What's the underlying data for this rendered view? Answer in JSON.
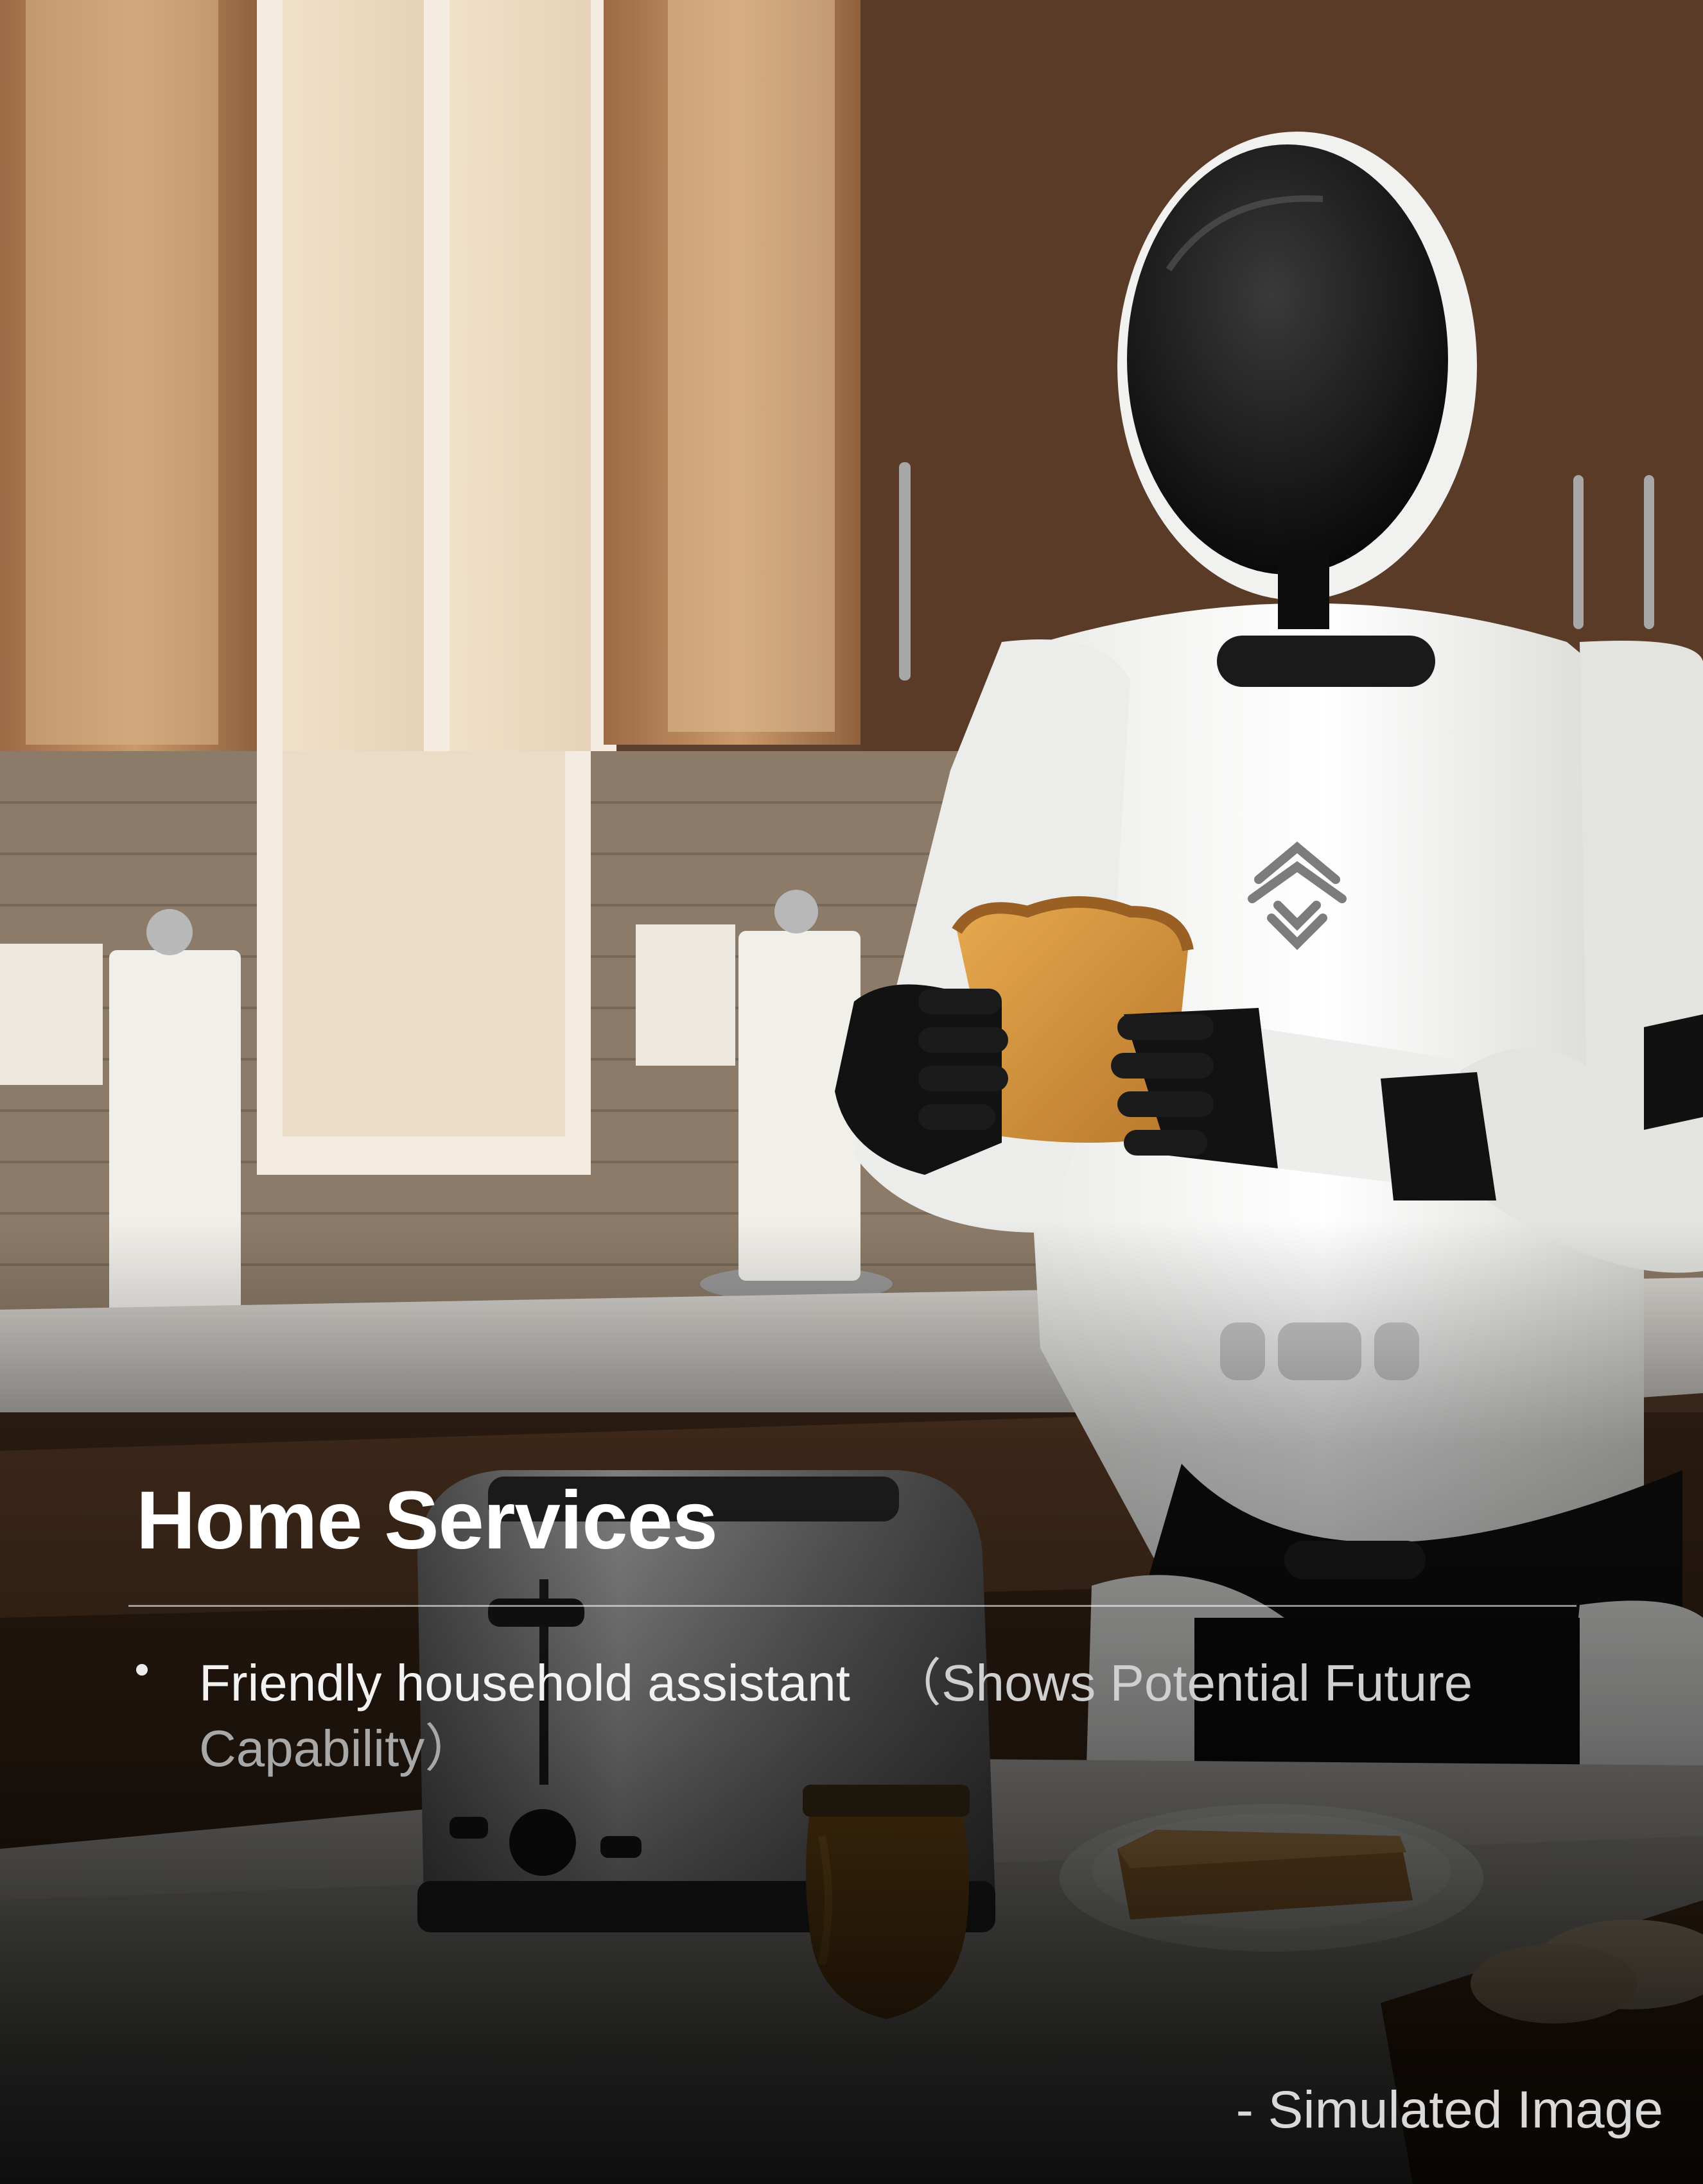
{
  "scene": {
    "description_icon": "robot-kitchen-photo"
  },
  "caption": {
    "title": "Home Services",
    "bullet_main": "Friendly household assistant",
    "bullet_note_line1": "（Shows Potential Future",
    "bullet_note_line2": "Capability）"
  },
  "footer": {
    "label": "-  Simulated Image"
  }
}
